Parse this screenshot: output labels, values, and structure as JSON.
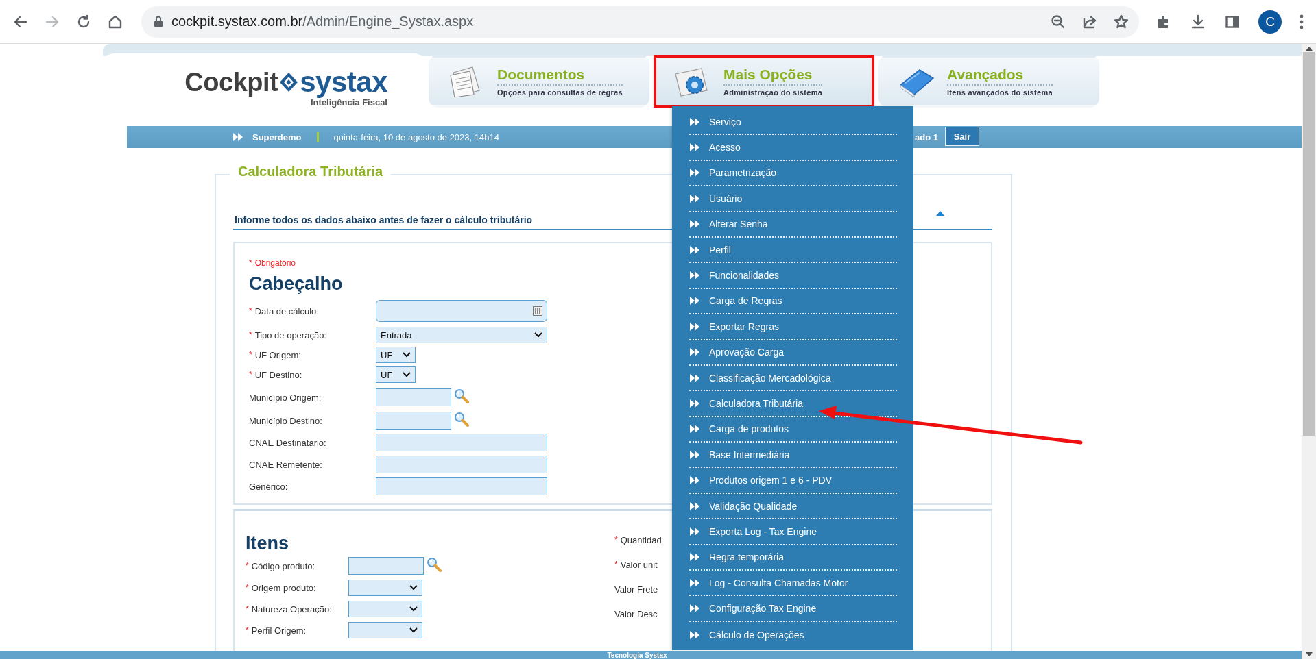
{
  "browser": {
    "url_host": "cockpit.systax.com.br",
    "url_path": "/Admin/Engine_Systax.aspx",
    "profile_initial": "C"
  },
  "header": {
    "logo": {
      "brand_left": "Cockpit",
      "brand_right": "systax",
      "tagline": "Inteligência Fiscal"
    },
    "tabs": [
      {
        "kind": "documents",
        "title": "Documentos",
        "subtitle": "Opções para consultas de regras",
        "selected": false
      },
      {
        "kind": "gear",
        "title": "Mais Opções",
        "subtitle": "Administração do sistema",
        "selected": true
      },
      {
        "kind": "book",
        "title": "Avançados",
        "subtitle": "Itens avançados do sistema",
        "selected": false
      }
    ]
  },
  "info_bar": {
    "user": "Superdemo",
    "date": "quinta-feira, 10 de agosto de 2023, 14h14",
    "status_fragment": "ado 1",
    "logout": "Sair"
  },
  "page": {
    "title": "Calculadora Tributária",
    "instruction": "Informe todos os dados abaixo antes de fazer o cálculo tributário",
    "header_section": {
      "required_note": {
        "mark": "*",
        "text": "Obrigatório"
      },
      "title": "Cabeçalho",
      "fields": [
        {
          "kind": "date",
          "mark": "*",
          "label": "Data de cálculo:"
        },
        {
          "kind": "select",
          "mark": "*",
          "label": "Tipo de operação:",
          "value": "Entrada"
        },
        {
          "kind": "select_small",
          "mark": "*",
          "label": "UF Origem:",
          "value": "UF"
        },
        {
          "kind": "select_small",
          "mark": "*",
          "label": "UF Destino:",
          "value": "UF"
        },
        {
          "kind": "lookup",
          "label": "Município Origem:"
        },
        {
          "kind": "lookup",
          "label": "Município Destino:"
        },
        {
          "kind": "text",
          "label": "CNAE Destinatário:"
        },
        {
          "kind": "text",
          "label": "CNAE Remetente:"
        },
        {
          "kind": "text",
          "label": "Genérico:"
        }
      ]
    },
    "items_section": {
      "title": "Itens",
      "left_fields": [
        {
          "kind": "lookup",
          "mark": "*",
          "label": "Código produto:"
        },
        {
          "kind": "select",
          "mark": "*",
          "label": "Origem produto:"
        },
        {
          "kind": "select",
          "mark": "*",
          "label": "Natureza Operação:"
        },
        {
          "kind": "select",
          "mark": "*",
          "label": "Perfil Origem:"
        }
      ],
      "right_fields": [
        {
          "kind": "text",
          "mark": "*",
          "label": "Quantidad"
        },
        {
          "kind": "text",
          "mark": "*",
          "label": "Valor unit"
        },
        {
          "kind": "text",
          "label": "Valor Frete"
        },
        {
          "kind": "text",
          "label": "Valor Desc"
        }
      ]
    }
  },
  "dropdown_menu": {
    "items": [
      "Serviço",
      "Acesso",
      "Parametrização",
      "Usuário",
      "Alterar Senha",
      "Perfil",
      "Funcionalidades",
      "Carga de Regras",
      "Exportar Regras",
      "Aprovação Carga",
      "Classificação Mercadológica",
      "Calculadora Tributária",
      "Carga de produtos",
      "Base Intermediária",
      "Produtos origem 1 e 6 - PDV",
      "Validação Qualidade",
      "Exporta Log - Tax Engine",
      "Regra temporária",
      "Log - Consulta Chamadas Motor",
      "Configuração Tax Engine",
      "Cálculo de Operações"
    ]
  },
  "footer": {
    "text": "Tecnologia Systax"
  }
}
